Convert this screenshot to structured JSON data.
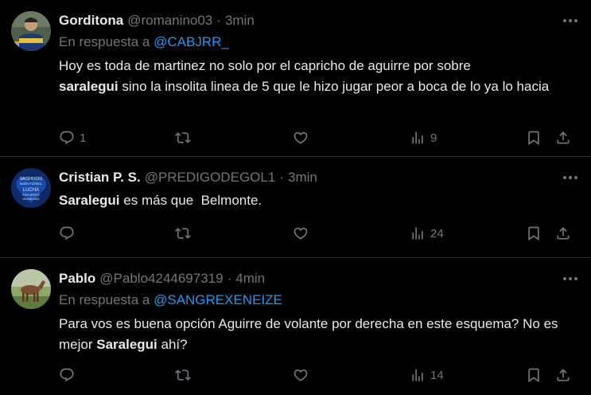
{
  "tweets": [
    {
      "name": "Gorditona",
      "handle": "@romanino03",
      "time": "3min",
      "reply_prefix": "En respuesta a",
      "reply_to": "@CABJRR_",
      "text_1": "Hoy es toda de martinez no solo por el capricho de aguirre por sobre",
      "bold": "saralegui",
      "text_2": " sino la insolita linea de 5 que le hizo jugar peor a boca de lo ya lo hacia",
      "replies": "1",
      "views": "9",
      "avatar_icon": "avatar-player-blue-shirt"
    },
    {
      "name": "Cristian P. S.",
      "handle": "@PREDIGODEGOL1",
      "time": "3min",
      "bold": "Saralegui",
      "text_2": " es más que  Belmonte.",
      "views": "24",
      "avatar_text": [
        "SACRIFICIO",
        "BUEN FÚTBOL",
        "LUCHA",
        "ESFUERZO",
        "HUMILDAD"
      ],
      "avatar_icon": "avatar-blue-heart-badge"
    },
    {
      "name": "Pablo",
      "handle": "@Pablo4244697319",
      "time": "4min",
      "reply_prefix": "En respuesta a",
      "reply_to": "@SANGREXENEIZE",
      "text_1": "Para vos es buena opción Aguirre de volante por derecha en este esquema? No es mejor ",
      "bold": "Saralegui",
      "text_2": " ahí?",
      "views": "14",
      "avatar_icon": "avatar-horse-field"
    }
  ],
  "dot": "·",
  "colors": {
    "background": "#000000",
    "text": "#e7e9ea",
    "muted": "#71767b",
    "link": "#1d9bf0",
    "divider": "#2f3336"
  }
}
